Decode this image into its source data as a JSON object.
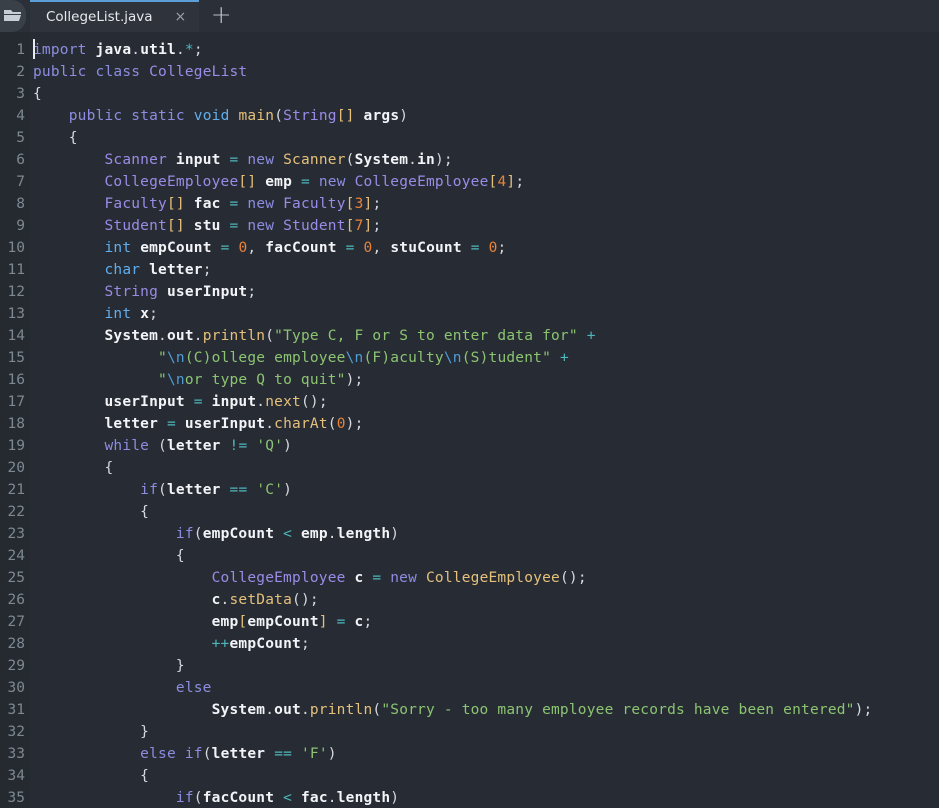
{
  "window": {
    "folder_icon": "open-folder-icon"
  },
  "tabbar": {
    "tabs": [
      {
        "title": "CollegeList.java",
        "close_label": "×",
        "active": true
      }
    ],
    "new_tab_label": "+"
  },
  "editor": {
    "language": "java",
    "first_visible_line": 1,
    "last_visible_line": 35,
    "caret_line": 1,
    "caret_column": 1,
    "line_numbers": [
      1,
      2,
      3,
      4,
      5,
      6,
      7,
      8,
      9,
      10,
      11,
      12,
      13,
      14,
      15,
      16,
      17,
      18,
      19,
      20,
      21,
      22,
      23,
      24,
      25,
      26,
      27,
      28,
      29,
      30,
      31,
      32,
      33,
      34,
      35
    ],
    "lines": [
      "import java.util.*;",
      "public class CollegeList",
      "{",
      "    public static void main(String[] args)",
      "    {",
      "        Scanner input = new Scanner(System.in);",
      "        CollegeEmployee[] emp = new CollegeEmployee[4];",
      "        Faculty[] fac = new Faculty[3];",
      "        Student[] stu = new Student[7];",
      "        int empCount = 0, facCount = 0, stuCount = 0;",
      "        char letter;",
      "        String userInput;",
      "        int x;",
      "        System.out.println(\"Type C, F or S to enter data for\" +",
      "              \"\\n(C)ollege employee\\n(F)aculty\\n(S)tudent\" +",
      "              \"\\nor type Q to quit\");",
      "        userInput = input.next();",
      "        letter = userInput.charAt(0);",
      "        while (letter != 'Q')",
      "        {",
      "            if(letter == 'C')",
      "            {",
      "                if(empCount < emp.length)",
      "                {",
      "                    CollegeEmployee c = new CollegeEmployee();",
      "                    c.setData();",
      "                    emp[empCount] = c;",
      "                    ++empCount;",
      "                }",
      "                else",
      "                    System.out.println(\"Sorry - too many employee records have been entered\");",
      "            }",
      "            else if(letter == 'F')",
      "            {",
      "                if(facCount < fac.length)"
    ],
    "colors": {
      "background": "#272c34",
      "gutter_background": "#252a31",
      "line_number": "#7d8893",
      "text": "#e8ebef",
      "keyword": "#8e8ce0",
      "primitive_type": "#61aeee",
      "class_type": "#9a8ce6",
      "function": "#e5c07b",
      "number": "#e8833a",
      "string": "#8cc472",
      "escape": "#4e9bd6",
      "operator": "#4db8bd",
      "bracket": "#e5c07b",
      "tabbar_background": "#2b3038",
      "active_tab_background": "#2f343c",
      "active_tab_accent": "#5c9fd6"
    }
  }
}
